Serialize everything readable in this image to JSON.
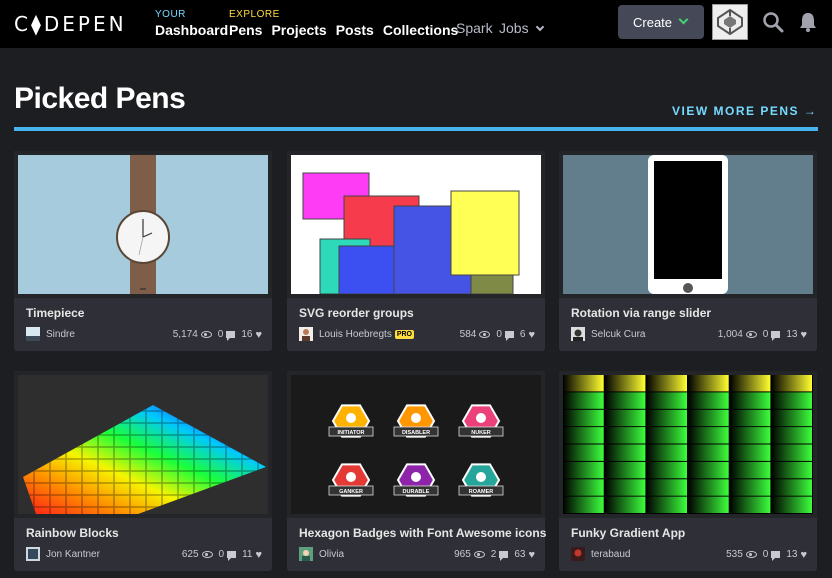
{
  "header": {
    "logo": "C⧫DEPEN",
    "your_label": "YOUR",
    "your_links": [
      "Dashboard"
    ],
    "explore_label": "EXPLORE",
    "explore_links": [
      "Pens",
      "Projects",
      "Posts",
      "Collections"
    ],
    "spark": "Spark",
    "jobs": "Jobs",
    "create_label": "Create",
    "icons": [
      "codepen-avatar-icon",
      "search-icon",
      "bell-icon"
    ]
  },
  "section": {
    "title": "Picked Pens",
    "view_more": "VIEW MORE PENS →"
  },
  "cards": [
    {
      "title": "Timepiece",
      "user": "Sindre",
      "pro": "",
      "views": "5,174",
      "comments": "0",
      "likes": "16"
    },
    {
      "title": "SVG reorder groups",
      "user": "Louis Hoebregts",
      "pro": "PRO",
      "views": "584",
      "comments": "0",
      "likes": "6"
    },
    {
      "title": "Rotation via range slider",
      "user": "Selcuk Cura",
      "pro": "",
      "views": "1,004",
      "comments": "0",
      "likes": "13"
    },
    {
      "title": "Rainbow Blocks",
      "user": "Jon Kantner",
      "pro": "",
      "views": "625",
      "comments": "0",
      "likes": "11"
    },
    {
      "title": "Hexagon Badges with Font Awesome icons",
      "user": "Olivia",
      "pro": "",
      "views": "965",
      "comments": "2",
      "likes": "63"
    },
    {
      "title": "Funky Gradient App",
      "user": "terabaud",
      "pro": "",
      "views": "535",
      "comments": "0",
      "likes": "13"
    }
  ],
  "badges": [
    "INITIATOR",
    "DISABLER",
    "NUKER",
    "GANKER",
    "DURABLE",
    "ROAMER"
  ],
  "colors": {
    "accent_blue": "#47b4f0",
    "create_green": "#47cf73",
    "explore_yellow": "#ffdd40"
  }
}
